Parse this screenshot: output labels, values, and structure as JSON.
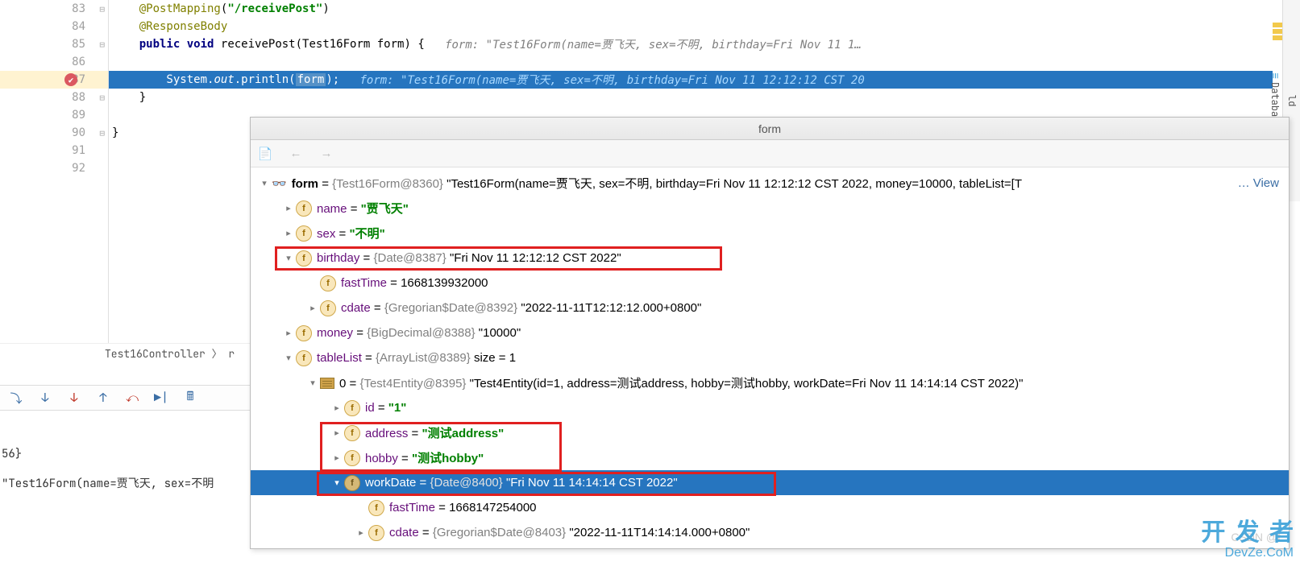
{
  "editor": {
    "lines": {
      "l83": {
        "num": "83",
        "annotation": "@PostMapping",
        "paren_open": "(",
        "str": "\"/receivePost\"",
        "paren_close": ")"
      },
      "l84": {
        "num": "84",
        "annotation": "@ResponseBody"
      },
      "l85": {
        "num": "85",
        "kw1": "public",
        "kw2": "void",
        "method": "receivePost",
        "params": "(Test16Form form) {",
        "hint": "form: \"Test16Form(name=贾飞天, sex=不明, birthday=Fri Nov 11 1…"
      },
      "l86": {
        "num": "86"
      },
      "l87": {
        "num": "87",
        "pre": "        System.",
        "out": "out",
        "mid": ".println(",
        "arg": "form",
        "post": ");",
        "hint": "form: \"Test16Form(name=贾飞天, sex=不明, birthday=Fri Nov 11 12:12:12 CST 20"
      },
      "l88": {
        "num": "88",
        "text": "    }"
      },
      "l89": {
        "num": "89"
      },
      "l90": {
        "num": "90",
        "text": "}"
      },
      "l91": {
        "num": "91"
      },
      "l92": {
        "num": "92"
      }
    }
  },
  "right_tabs": {
    "database": "Database",
    "ld": "ld"
  },
  "breadcrumb": {
    "text": "Test16Controller 〉 r"
  },
  "bottom": {
    "line1": "56}",
    "line2": "\"Test16Form(name=贾飞天, sex=不明"
  },
  "popup": {
    "title": "form",
    "root": {
      "name": "form",
      "type": "{Test16Form@8360}",
      "value": "\"Test16Form(name=贾飞天, sex=不明, birthday=Fri Nov 11 12:12:12 CST 2022, money=10000, tableList=[T",
      "view": "… View"
    },
    "rows": {
      "name": {
        "label": "name",
        "eq": " = ",
        "val": "\"贾飞天\""
      },
      "sex": {
        "label": "sex",
        "eq": " = ",
        "val": "\"不明\""
      },
      "birthday": {
        "label": "birthday",
        "eq": " = ",
        "type": "{Date@8387} ",
        "val": "\"Fri Nov 11 12:12:12 CST 2022\""
      },
      "fastTime1": {
        "label": "fastTime",
        "eq": " = ",
        "val": "1668139932000"
      },
      "cdate1": {
        "label": "cdate",
        "eq": " = ",
        "type": "{Gregorian$Date@8392} ",
        "val": "\"2022-11-11T12:12:12.000+0800\""
      },
      "money": {
        "label": "money",
        "eq": " = ",
        "type": "{BigDecimal@8388} ",
        "val": "\"10000\""
      },
      "tableList": {
        "label": "tableList",
        "eq": " = ",
        "type": "{ArrayList@8389} ",
        "extra": " size = 1"
      },
      "idx0": {
        "label": "0",
        "eq": " = ",
        "type": "{Test4Entity@8395} ",
        "val": "\"Test4Entity(id=1, address=测试address, hobby=测试hobby, workDate=Fri Nov 11 14:14:14 CST 2022)\""
      },
      "id": {
        "label": "id",
        "eq": " = ",
        "val": "\"1\""
      },
      "address": {
        "label": "address",
        "eq": " = ",
        "val": "\"测试address\""
      },
      "hobby": {
        "label": "hobby",
        "eq": " = ",
        "val": "\"测试hobby\""
      },
      "workDate": {
        "label": "workDate",
        "eq": " = ",
        "type": "{Date@8400} ",
        "val": "\"Fri Nov 11 14:14:14 CST 2022\""
      },
      "fastTime2": {
        "label": "fastTime",
        "eq": " = ",
        "val": "1668147254000"
      },
      "cdate2": {
        "label": "cdate",
        "eq": " = ",
        "type": "{Gregorian$Date@8403} ",
        "val": "\"2022-11-11T14:14:14.000+0800\""
      }
    }
  },
  "watermark": {
    "csdn": "CSDN @f",
    "big": "开 发 者",
    "sub": "DevZe.CoM"
  }
}
